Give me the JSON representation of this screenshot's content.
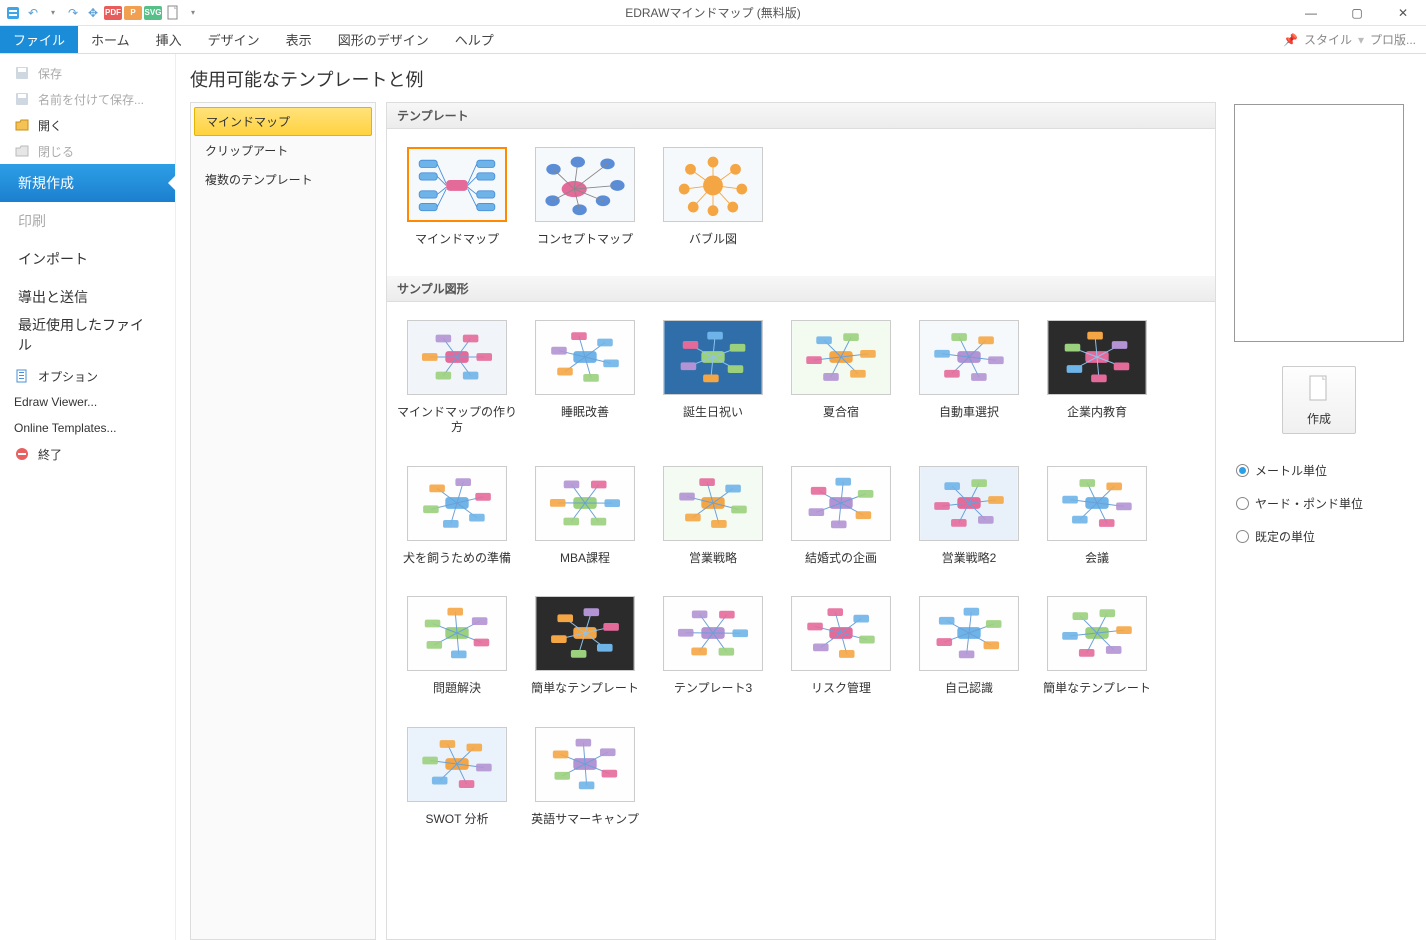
{
  "window": {
    "title": "EDRAWマインドマップ (無料版)"
  },
  "menubar": {
    "file": "ファイル",
    "tabs": [
      "ホーム",
      "挿入",
      "デザイン",
      "表示",
      "図形のデザイン",
      "ヘルプ"
    ],
    "right": {
      "style": "スタイル",
      "pro": "プロ版..."
    },
    "pin_icon": "📌"
  },
  "sidebar": {
    "save": "保存",
    "save_as": "名前を付けて保存...",
    "open": "開く",
    "close": "閉じる",
    "new": "新規作成",
    "print": "印刷",
    "import": "インポート",
    "export": "導出と送信",
    "recent": "最近使用したファイル",
    "options": "オプション",
    "viewer": "Edraw Viewer...",
    "online": "Online Templates...",
    "exit": "終了"
  },
  "main": {
    "heading": "使用可能なテンプレートと例",
    "categories": [
      "マインドマップ",
      "クリップアート",
      "複数のテンプレート"
    ],
    "templates_section": "テンプレート",
    "templates": [
      "マインドマップ",
      "コンセプトマップ",
      "バブル図"
    ],
    "samples_section": "サンプル図形",
    "samples": [
      "マインドマップの作り方",
      "睡眠改善",
      "誕生日祝い",
      "夏合宿",
      "自動車選択",
      "企業内教育",
      "犬を飼うための準備",
      "MBA課程",
      "営業戦略",
      "結婚式の企画",
      "営業戦略2",
      "会議",
      "問題解決",
      "簡単なテンプレート",
      "テンプレート3",
      "リスク管理",
      "自己認識",
      "簡単なテンプレート",
      "SWOT 分析",
      "英語サマーキャンプ"
    ]
  },
  "rightpane": {
    "create": "作成",
    "radios": [
      "メートル単位",
      "ヤード・ポンド単位",
      "既定の単位"
    ],
    "radio_selected": 0
  }
}
